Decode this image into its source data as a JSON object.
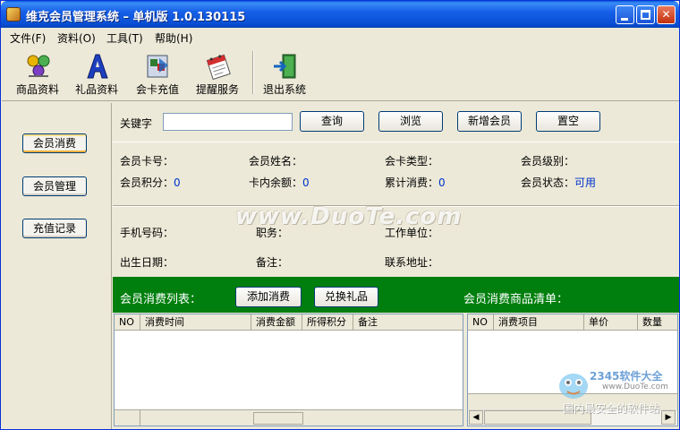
{
  "window": {
    "title": "维克会员管理系统 – 单机版 1.0.130115",
    "controls": {
      "minimize": "minimize-icon",
      "maximize": "maximize-icon",
      "close": "✕"
    }
  },
  "menu": [
    "文件(F)",
    "资料(O)",
    "工具(T)",
    "帮助(H)"
  ],
  "toolbar": [
    {
      "label": "商品资料",
      "icon": "products-icon"
    },
    {
      "label": "礼品资料",
      "icon": "gift-icon"
    },
    {
      "label": "会卡充值",
      "icon": "card-recharge-icon"
    },
    {
      "label": "提醒服务",
      "icon": "reminder-icon"
    },
    {
      "label": "退出系统",
      "icon": "exit-icon"
    }
  ],
  "nav": [
    "会员消费",
    "会员管理",
    "充值记录"
  ],
  "search": {
    "label": "关键字",
    "value": "",
    "buttons": [
      "查询",
      "浏览",
      "新增会员",
      "置空"
    ]
  },
  "member": {
    "card_no_label": "会员卡号：",
    "name_label": "会员姓名：",
    "card_type_label": "会卡类型：",
    "level_label": "会员级别：",
    "points_label": "会员积分：",
    "points_value": "0",
    "balance_label": "卡内余额：",
    "balance_value": "0",
    "total_label": "累计消费：",
    "total_value": "0",
    "status_label": "会员状态：",
    "status_value": "可用",
    "phone_label": "手机号码：",
    "job_label": "职务：",
    "company_label": "工作单位：",
    "birth_label": "出生日期：",
    "note_label": "备注：",
    "address_label": "联系地址："
  },
  "watermark": "www.DuoTe.com",
  "consumption": {
    "title": "会员消费列表：",
    "add_button": "添加消费",
    "redeem_button": "兑换礼品",
    "columns": [
      "NO",
      "消费时间",
      "消费金额",
      "所得积分",
      "备注"
    ]
  },
  "items": {
    "title": "会员消费商品清单：",
    "columns": [
      "NO",
      "消费项目",
      "单价",
      "数量"
    ]
  },
  "brand_watermark": {
    "line1": "2345软件大全",
    "line2": "www.DuoTe.com",
    "line3": "国内最安全的软件站"
  }
}
